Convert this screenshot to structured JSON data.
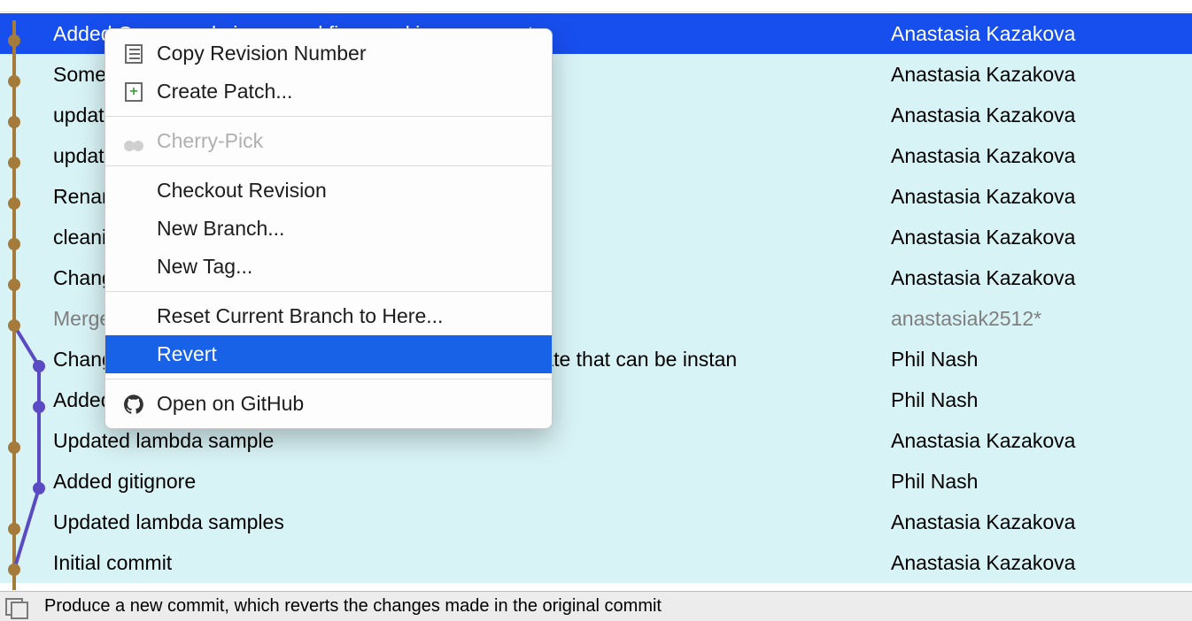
{
  "selectedIndex": 0,
  "commits": [
    {
      "message": "Added C++ sample in general fixes and improvements",
      "author": "Anastasia Kazakova",
      "lane": 0,
      "merge": false,
      "branchDot": false
    },
    {
      "message": "Some inaccuracy catched",
      "author": "Anastasia Kazakova",
      "lane": 0,
      "merge": false,
      "branchDot": false
    },
    {
      "message": "update formatting",
      "author": "Anastasia Kazakova",
      "lane": 0,
      "merge": false,
      "branchDot": false
    },
    {
      "message": "update formatting",
      "author": "Anastasia Kazakova",
      "lane": 0,
      "merge": false,
      "branchDot": false
    },
    {
      "message": "Rename target",
      "author": "Anastasia Kazakova",
      "lane": 0,
      "merge": false,
      "branchDot": false
    },
    {
      "message": "cleaning the code sample",
      "author": "Anastasia Kazakova",
      "lane": 0,
      "merge": false,
      "branchDot": false
    },
    {
      "message": "Change the project structure",
      "author": "Anastasia Kazakova",
      "lane": 0,
      "merge": false,
      "branchDot": false
    },
    {
      "message": "Merge pull request #1 from philsquared/master",
      "author": "anastasiak2512*",
      "lane": 0,
      "merge": true,
      "branchDot": false
    },
    {
      "message": "Changed theAnswer() in Catch test to a variable template that can be instan",
      "author": "Phil Nash",
      "lane": 1,
      "merge": false,
      "branchDot": true
    },
    {
      "message": "Added more return type deduction examples",
      "author": "Phil Nash",
      "lane": 1,
      "merge": false,
      "branchDot": true
    },
    {
      "message": "Updated lambda sample",
      "author": "Anastasia Kazakova",
      "lane": 0,
      "merge": false,
      "branchDot": false
    },
    {
      "message": "Added gitignore",
      "author": "Phil Nash",
      "lane": 1,
      "merge": false,
      "branchDot": true
    },
    {
      "message": "Updated lambda samples",
      "author": "Anastasia Kazakova",
      "lane": 0,
      "merge": false,
      "branchDot": false
    },
    {
      "message": "Initial commit",
      "author": "Anastasia Kazakova",
      "lane": 0,
      "merge": false,
      "branchDot": false
    }
  ],
  "menu": {
    "copy": "Copy Revision Number",
    "patch": "Create Patch...",
    "cherry": "Cherry-Pick",
    "checkout": "Checkout Revision",
    "branch": "New Branch...",
    "tag": "New Tag...",
    "reset": "Reset Current Branch to Here...",
    "revert": "Revert",
    "github": "Open on GitHub"
  },
  "status": "Produce a new commit, which reverts the changes made in the original commit",
  "graph": {
    "mainColor": "#a57b3b",
    "branchColor": "#5a4bc4",
    "mainX": 16,
    "branchX": 44
  }
}
